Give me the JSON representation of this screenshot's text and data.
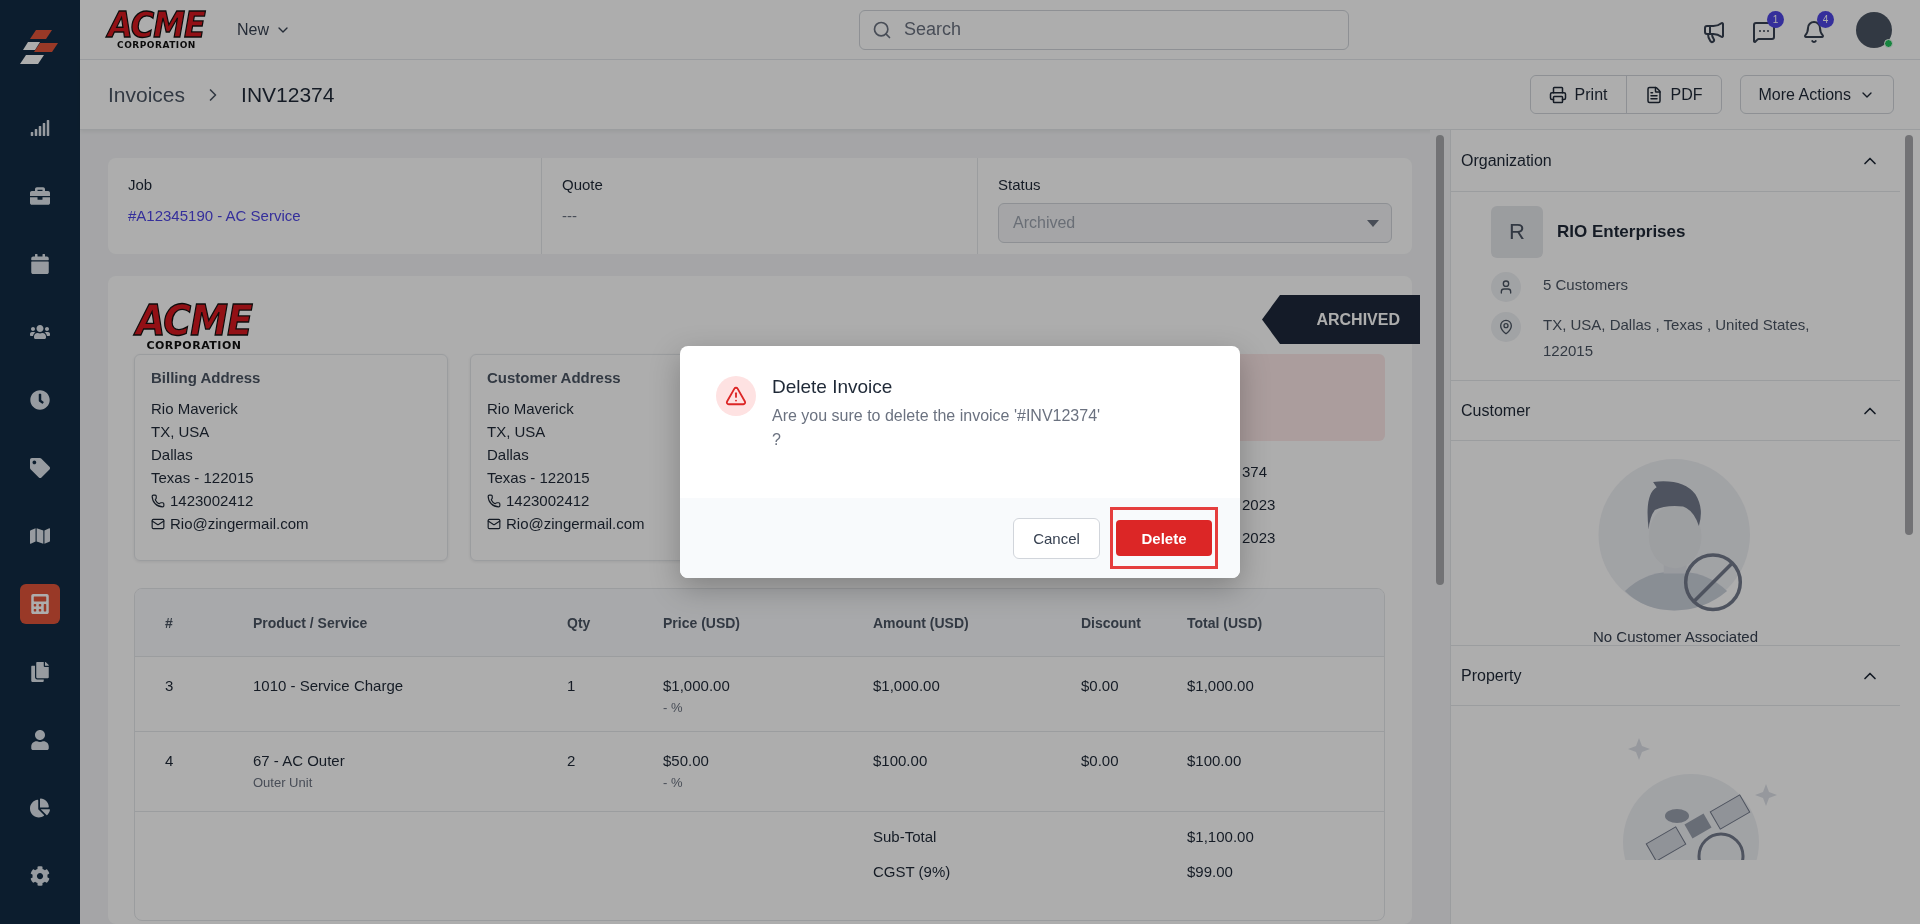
{
  "sidebar": {
    "items": [
      {
        "selected": false
      },
      {
        "selected": false
      },
      {
        "selected": false
      },
      {
        "selected": false
      },
      {
        "selected": false
      },
      {
        "selected": false
      },
      {
        "selected": false
      },
      {
        "selected": true
      },
      {
        "selected": false
      },
      {
        "selected": false
      },
      {
        "selected": false
      },
      {
        "selected": false
      }
    ]
  },
  "topbar": {
    "logo": {
      "name": "ACME",
      "tagline": "CORPORATION"
    },
    "new_menu": "New",
    "search": {
      "placeholder": "Search"
    },
    "chat_badge": "1",
    "notification_badge": "4"
  },
  "breadcrumb": {
    "parent": "Invoices",
    "current": "INV12374"
  },
  "actions": {
    "print": "Print",
    "pdf": "PDF",
    "more": "More Actions"
  },
  "summary": {
    "job": {
      "label": "Job",
      "value": "#A12345190 - AC Service"
    },
    "quote": {
      "label": "Quote",
      "value": "---"
    },
    "status": {
      "label": "Status",
      "value": "Archived",
      "disabled": true
    }
  },
  "invoice": {
    "logo": {
      "name": "ACME",
      "tagline": "CORPORATION"
    },
    "ribbon": "ARCHIVED",
    "addresses": [
      {
        "title": "Billing Address",
        "lines": [
          "Rio Maverick",
          "TX, USA",
          "Dallas",
          "Texas - 122015"
        ],
        "phone": "1423002412",
        "email": "Rio@zingermail.com"
      },
      {
        "title": "Customer Address",
        "lines": [
          "Rio Maverick",
          "TX, USA",
          "Dallas",
          "Texas - 122015"
        ],
        "phone": "1423002412",
        "email": "Rio@zingermail.com"
      }
    ],
    "detail_fragments": [
      "374",
      "2023",
      "2023"
    ],
    "table": {
      "columns": [
        "#",
        "Product / Service",
        "Qty",
        "Price (USD)",
        "Amount (USD)",
        "Discount",
        "Total (USD)"
      ],
      "rows": [
        {
          "number": "3",
          "product": "1010 - Service Charge",
          "qty": "1",
          "price": "$1,000.00",
          "price_note": "- %",
          "amount": "$1,000.00",
          "discount": "$0.00",
          "total": "$1,000.00"
        },
        {
          "number": "4",
          "product": "67 - AC Outer",
          "description": "Outer Unit",
          "qty": "2",
          "price": "$50.00",
          "price_note": "- %",
          "amount": "$100.00",
          "discount": "$0.00",
          "total": "$100.00"
        }
      ],
      "totals": [
        {
          "label": "Sub-Total",
          "value": "$1,100.00"
        },
        {
          "label": "CGST (9%)",
          "value": "$99.00"
        }
      ]
    }
  },
  "right_panel": {
    "organization": {
      "title": "Organization",
      "expanded": true,
      "initial": "R",
      "name": "RIO Enterprises",
      "customers": "5 Customers",
      "address": "TX, USA, Dallas , Texas , United States, 122015"
    },
    "customer": {
      "title": "Customer",
      "expanded": true,
      "empty_text": "No Customer Associated"
    },
    "property": {
      "title": "Property",
      "expanded": true
    }
  },
  "dialog": {
    "title": "Delete Invoice",
    "message": "Are you sure to delete the invoice '#INV12374'\n?",
    "cancel": "Cancel",
    "confirm": "Delete"
  }
}
